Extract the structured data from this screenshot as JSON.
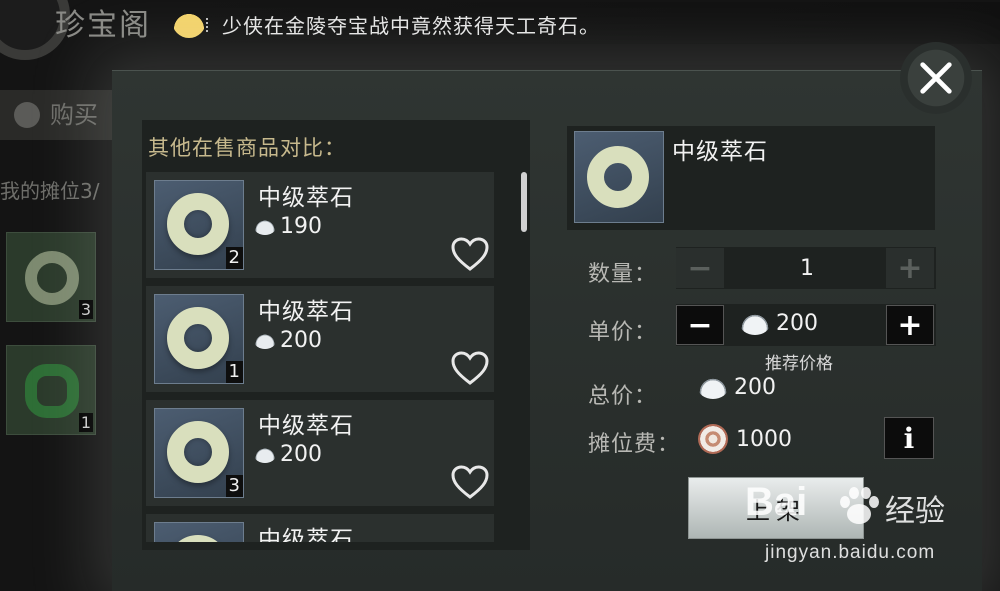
{
  "background": {
    "screen_title": "珍宝阁",
    "tab_label": "购买",
    "stall_text": "我的摊位3/",
    "items": [
      {
        "qty": "3"
      },
      {
        "qty": "1"
      }
    ]
  },
  "banner": {
    "text": "少侠在金陵夺宝战中竟然获得天工奇石。"
  },
  "compare": {
    "title": "其他在售商品对比：",
    "items": [
      {
        "name": "中级萃石",
        "price": "190",
        "qty": "2"
      },
      {
        "name": "中级萃石",
        "price": "200",
        "qty": "1"
      },
      {
        "name": "中级萃石",
        "price": "200",
        "qty": "3"
      },
      {
        "name": "中级萃石",
        "price": "",
        "qty": ""
      }
    ]
  },
  "product": {
    "name": "中级萃石"
  },
  "form": {
    "quantity_label": "数量：",
    "quantity_value": "1",
    "unit_price_label": "单价：",
    "unit_price_value": "200",
    "recommend_label": "推荐价格",
    "total_label": "总价：",
    "total_value": "200",
    "fee_label": "摊位费：",
    "fee_value": "1000",
    "info_label": "i",
    "list_button": "上架",
    "minus": "−",
    "plus": "+"
  },
  "watermark": {
    "logo": "Bai",
    "logo_cn": "经验",
    "url": "jingyan.baidu.com"
  },
  "colors": {
    "accent_title": "#c7b98d",
    "panel_bg": "#1e2220",
    "dialog_bg": "#2f3532"
  }
}
